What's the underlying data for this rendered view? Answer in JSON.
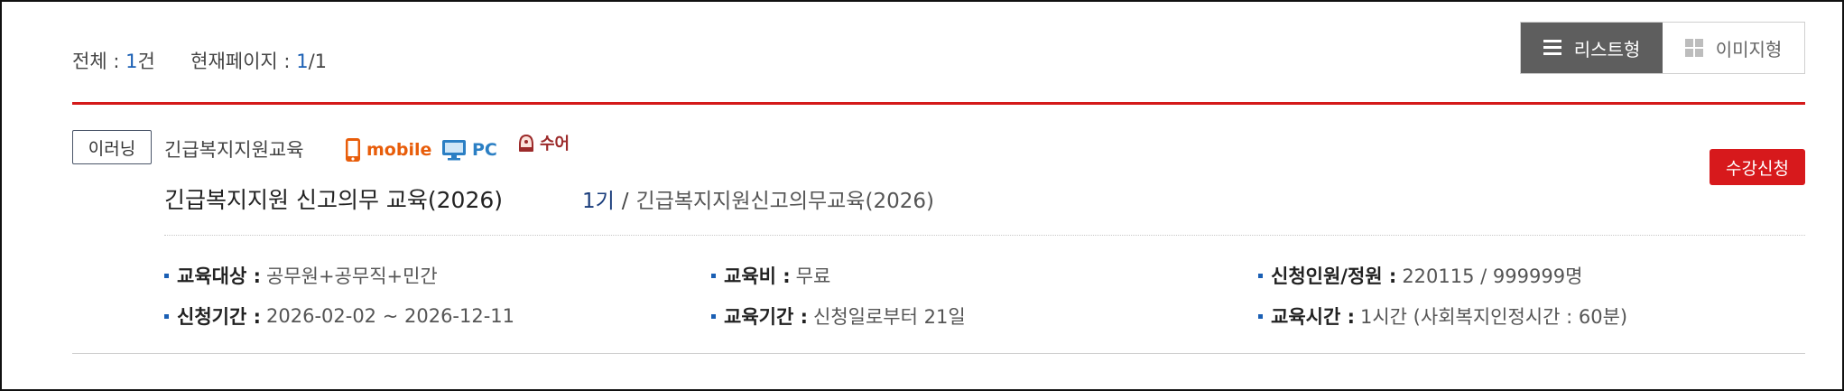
{
  "summary": {
    "total_label": "전체 : ",
    "total_count": "1",
    "total_unit": "건",
    "page_label": "현재페이지 : ",
    "page_current": "1",
    "page_total": "/1"
  },
  "view_toggle": {
    "list_label": "리스트형",
    "image_label": "이미지형",
    "active": "list"
  },
  "course": {
    "type_badge": "이러닝",
    "category": "긴급복지지원교육",
    "devices": {
      "mobile_label": "mobile",
      "pc_label": "PC",
      "sign_label": "수어"
    },
    "title": "긴급복지지원 신고의무 교육(2026)",
    "cohort_number": "1기",
    "cohort_separator": "/",
    "cohort_name": "긴급복지지원신고의무교육(2026)",
    "apply_label": "수강신청",
    "info": {
      "target_label": "교육대상 :",
      "target_value": "공무원+공무직+민간",
      "fee_label": "교육비 :",
      "fee_value": "무료",
      "capacity_label": "신청인원/정원 :",
      "capacity_value": "220115 / 999999명",
      "apply_period_label": "신청기간 :",
      "apply_period_value": "2026-02-02 ~ 2026-12-11",
      "edu_period_label": "교육기간 :",
      "edu_period_value": "신청일로부터 21일",
      "edu_time_label": "교육시간 :",
      "edu_time_value": "1시간 (사회복지인정시간 : 60분)"
    }
  },
  "colors": {
    "accent_blue": "#1a5fb4",
    "rule_red": "#d41a1a",
    "apply_red": "#d7191c",
    "toggle_active": "#5e5e5e",
    "mobile_orange": "#e85d0a",
    "pc_blue": "#2b7fc4",
    "sign_brown": "#9c2a2a"
  }
}
